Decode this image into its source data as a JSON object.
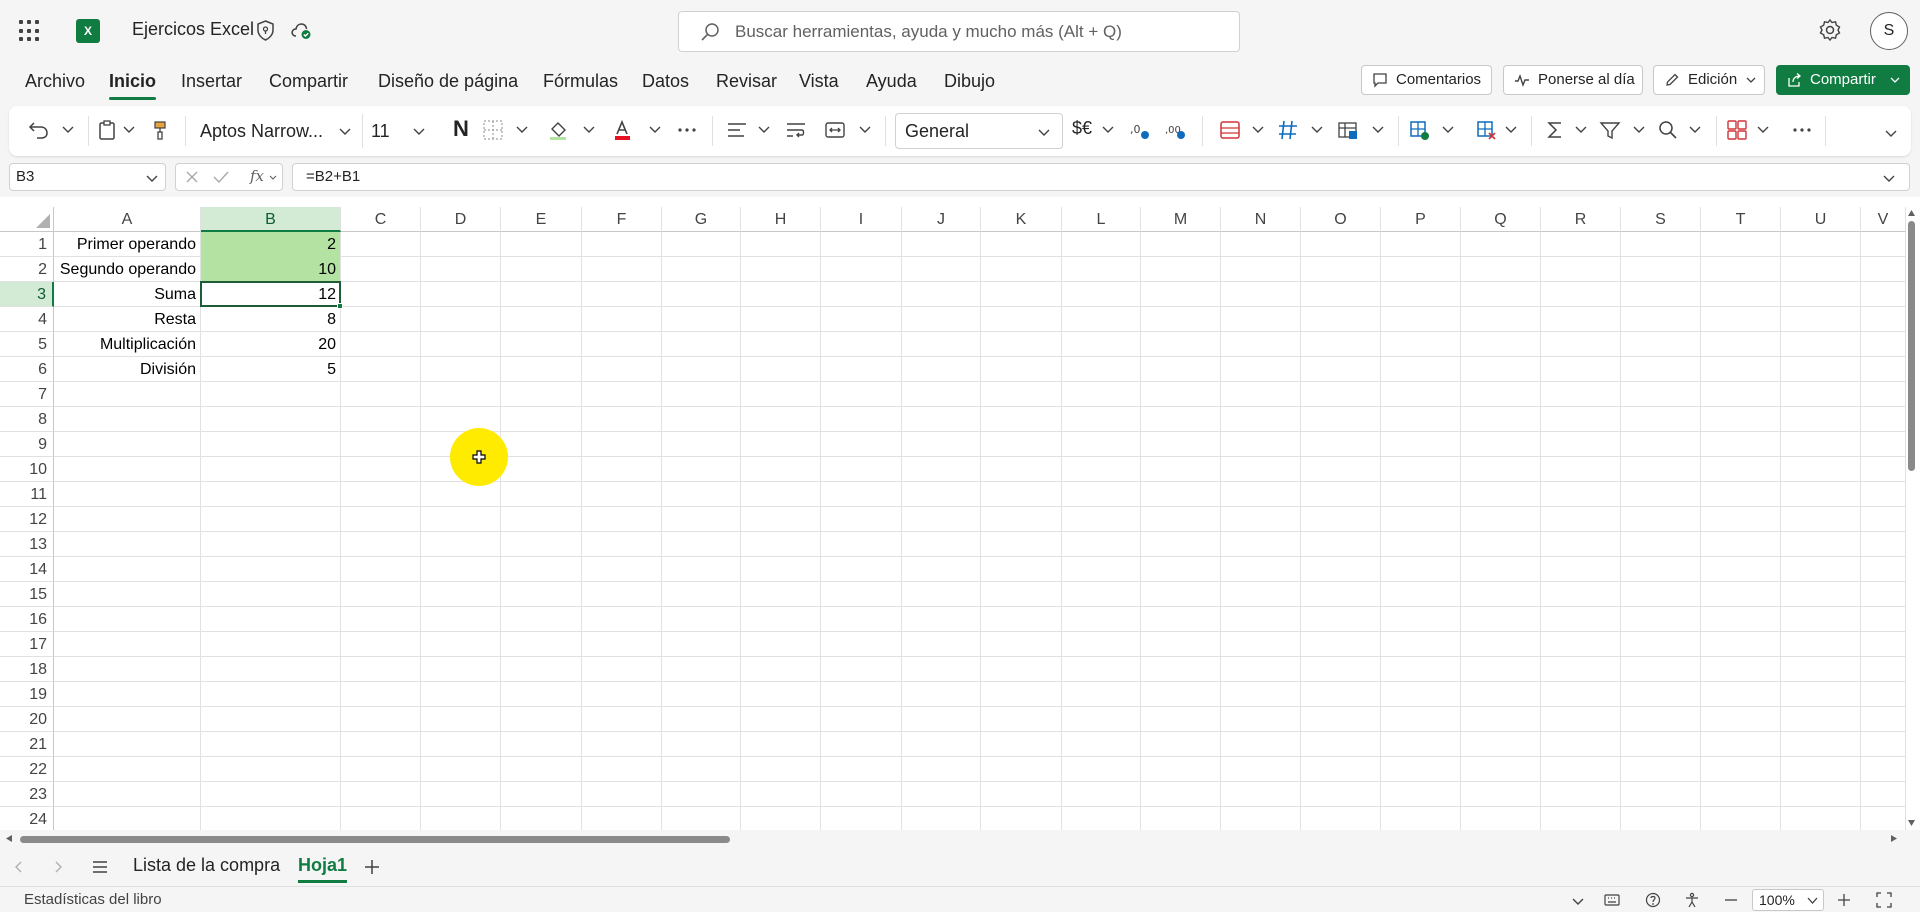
{
  "titlebar": {
    "doc_title": "Ejercicos Excel",
    "search_placeholder": "Buscar herramientas, ayuda y mucho más (Alt + Q)",
    "avatar_initial": "S"
  },
  "menu": {
    "items": [
      "Archivo",
      "Inicio",
      "Insertar",
      "Compartir",
      "Diseño de página",
      "Fórmulas",
      "Datos",
      "Revisar",
      "Vista",
      "Ayuda",
      "Dibujo"
    ],
    "active": "Inicio",
    "comments_label": "Comentarios",
    "catchup_label": "Ponerse al día",
    "editing_label": "Edición",
    "share_label": "Compartir"
  },
  "ribbon": {
    "font_name": "Aptos Narrow...",
    "font_size": "11",
    "bold_glyph": "N",
    "number_format": "General",
    "currency_label": "$€"
  },
  "formula_bar": {
    "name_box": "B3",
    "fx_label": "fx",
    "formula": "=B2+B1"
  },
  "sheet": {
    "columns": [
      "A",
      "B",
      "C",
      "D",
      "E",
      "F",
      "G",
      "H",
      "I",
      "J",
      "K",
      "L",
      "M",
      "N",
      "O",
      "P",
      "Q",
      "R",
      "S",
      "T",
      "U",
      "V"
    ],
    "rows": [
      "1",
      "2",
      "3",
      "4",
      "5",
      "6",
      "7",
      "8",
      "9",
      "10",
      "11",
      "12",
      "13",
      "14",
      "15",
      "16",
      "17",
      "18",
      "19",
      "20",
      "21",
      "22",
      "23",
      "24"
    ],
    "selected_column": "B",
    "selected_row": "3",
    "cells": {
      "A1": "Primer operando",
      "B1": "2",
      "A2": "Segundo operando",
      "B2": "10",
      "A3": "Suma",
      "B3": "12",
      "A4": "Resta",
      "B4": "8",
      "A5": "Multiplicación",
      "B5": "20",
      "A6": "División",
      "B6": "5"
    },
    "highlight_color": "#b4e2a2"
  },
  "tabs": {
    "items": [
      "Lista de la compra",
      "Hoja1"
    ],
    "active": "Hoja1"
  },
  "status": {
    "left_text": "Estadísticas del libro",
    "zoom": "100%"
  },
  "colors": {
    "accent": "#107c41"
  }
}
